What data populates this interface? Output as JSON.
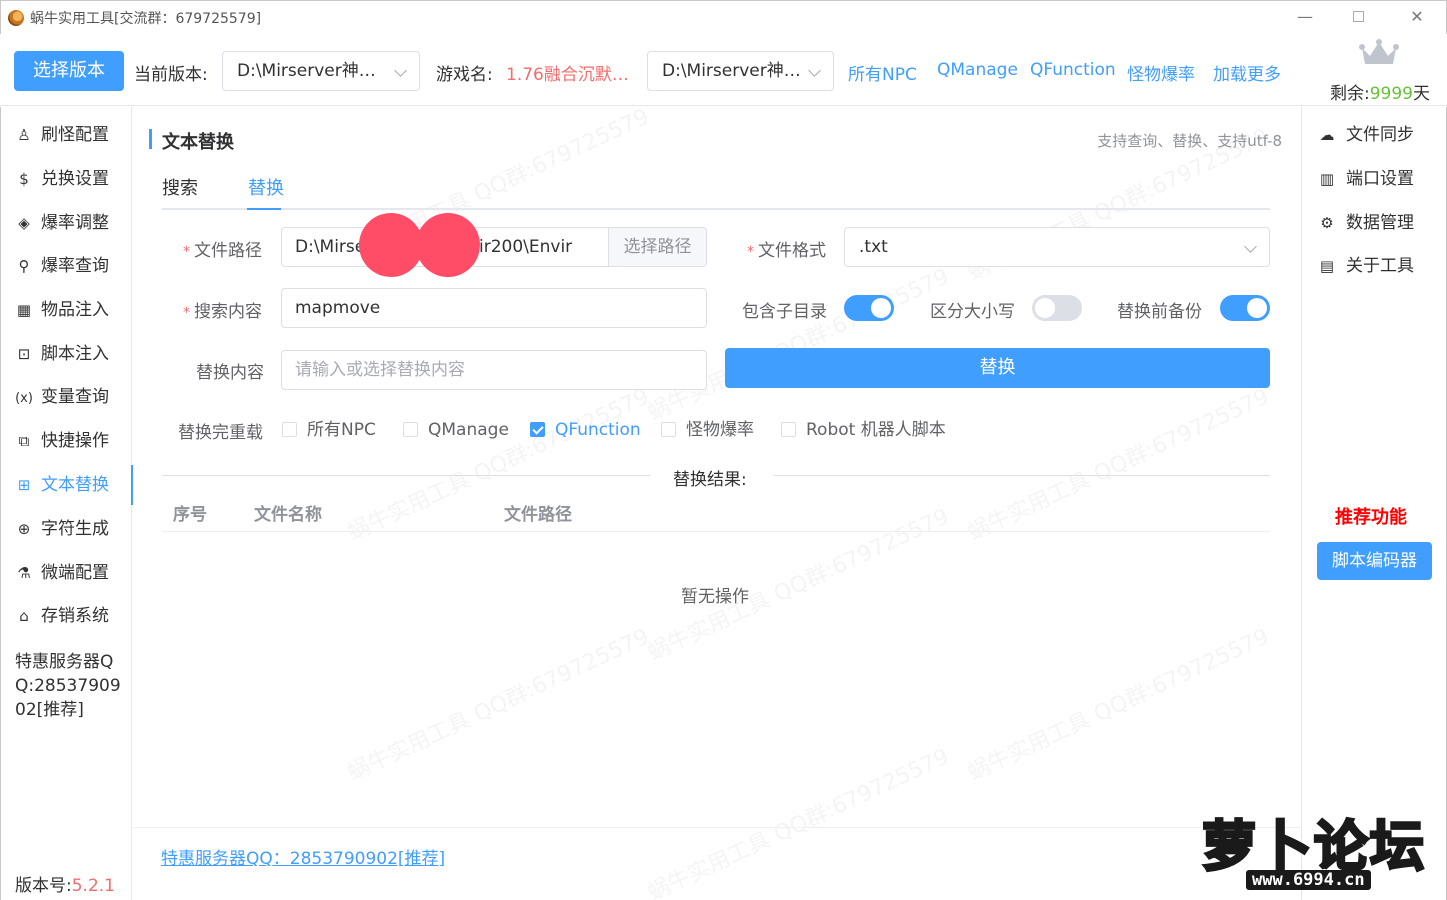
{
  "window": {
    "title": "蜗牛实用工具[交流群：679725579]"
  },
  "toolbar": {
    "select_version_label": "选择版本",
    "current_version_label": "当前版本:",
    "current_version_value": "D:\\Mirserver神…",
    "game_name_label": "游戏名:",
    "game_name_value": "1.76融合沉默…",
    "second_path_value": "D:\\Mirserver神…",
    "links": [
      "所有NPC",
      "QManage",
      "QFunction",
      "怪物爆率",
      "加载更多"
    ],
    "remain_label": "剩余:",
    "remain_days": "9999",
    "remain_unit": "天"
  },
  "sidebar": {
    "items": [
      {
        "label": "刷怪配置",
        "icon": "robot-icon"
      },
      {
        "label": "兑换设置",
        "icon": "dollar-icon"
      },
      {
        "label": "爆率调整",
        "icon": "cube-icon"
      },
      {
        "label": "爆率查询",
        "icon": "search-icon"
      },
      {
        "label": "物品注入",
        "icon": "grid-icon"
      },
      {
        "label": "脚本注入",
        "icon": "code-icon"
      },
      {
        "label": "变量查询",
        "icon": "variable-icon"
      },
      {
        "label": "快捷操作",
        "icon": "external-link-icon"
      },
      {
        "label": "文本替换",
        "icon": "connection-icon"
      },
      {
        "label": "字符生成",
        "icon": "lock-icon"
      },
      {
        "label": "微端配置",
        "icon": "microscope-icon"
      },
      {
        "label": "存销系统",
        "icon": "shop-icon"
      }
    ],
    "active_index": 8,
    "promo_text": "特惠服务器QQ:2853790902[推荐]",
    "version_label": "版本号:",
    "version_value": "5.2.1"
  },
  "main": {
    "section_title": "文本替换",
    "section_desc": "支持查询、替换、支持utf-8",
    "tabs": [
      "搜索",
      "替换"
    ],
    "active_tab": 1,
    "file_path_label": "文件路径",
    "file_path_left": "D:\\Mirse",
    "file_path_right": "ir200\\Envir",
    "choose_path_label": "选择路径",
    "file_format_label": "文件格式",
    "file_format_value": ".txt",
    "search_label": "搜索内容",
    "search_value": "mapmove",
    "include_subdir_label": "包含子目录",
    "case_sensitive_label": "区分大小写",
    "backup_label": "替换前备份",
    "replace_label": "替换内容",
    "replace_placeholder": "请输入或选择替换内容",
    "replace_button": "替换",
    "reload_label": "替换完重载",
    "reload_options": [
      {
        "label": "所有NPC",
        "checked": false
      },
      {
        "label": "QManage",
        "checked": false
      },
      {
        "label": "QFunction",
        "checked": true
      },
      {
        "label": "怪物爆率",
        "checked": false
      },
      {
        "label": "Robot 机器人脚本",
        "checked": false
      }
    ],
    "result_divider": "替换结果:",
    "table_headers": [
      "序号",
      "文件名称",
      "文件路径"
    ],
    "empty_text": "暂无操作",
    "bottom_link": "特惠服务器QQ：2853790902[推荐]"
  },
  "switches": {
    "include_subdir": true,
    "case_sensitive": false,
    "backup": true
  },
  "rsidebar": {
    "items": [
      {
        "label": "文件同步",
        "icon": "cloud-sync-icon"
      },
      {
        "label": "端口设置",
        "icon": "port-icon"
      },
      {
        "label": "数据管理",
        "icon": "gear-icon"
      },
      {
        "label": "关于工具",
        "icon": "clipboard-icon"
      }
    ],
    "recommend_label": "推荐功能",
    "encoder_button": "脚本编码器"
  },
  "logo": {
    "main": "萝卜论坛",
    "sub": "www.6994.cn"
  },
  "colors": {
    "accent": "#409eff",
    "danger": "#f56c6c",
    "success": "#67c23a",
    "recommend": "#ff0000"
  }
}
